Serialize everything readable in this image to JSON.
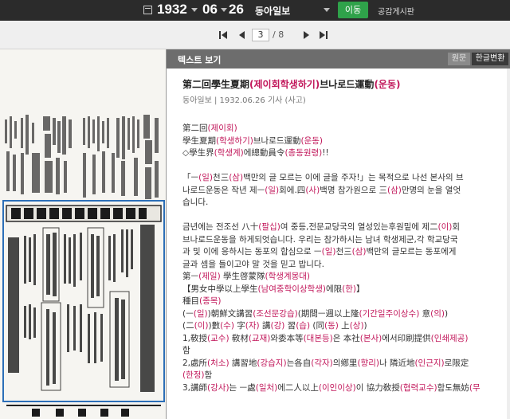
{
  "topbar": {
    "year": "1932",
    "month": "06",
    "day": "26",
    "newspaper": "동아일보",
    "go_label": "이동",
    "board_label": "공감게시판"
  },
  "pager": {
    "current_page": "3",
    "separator": "/",
    "total_pages": "8"
  },
  "panel": {
    "title": "텍스트 보기",
    "original_label": "원문",
    "convert_label": "한글변환"
  },
  "article": {
    "headline": [
      {
        "t": "第二回學生夏期"
      },
      {
        "t": "(제이회학생하기)",
        "h": true
      },
      {
        "t": "브나로드運動"
      },
      {
        "t": "(운동)",
        "h": true
      }
    ],
    "meta": "동아일보 | 1932.06.26 기사 (사고)",
    "lines": [
      [
        {
          "t": "第二回"
        },
        {
          "t": "(제이회)",
          "h": true
        }
      ],
      [
        {
          "t": "學生夏期"
        },
        {
          "t": "(학생하기)",
          "h": true
        },
        {
          "t": "브나로드運動"
        },
        {
          "t": "(운동)",
          "h": true
        }
      ],
      [
        {
          "t": "◇學生界"
        },
        {
          "t": "(학생계)",
          "h": true
        },
        {
          "t": "에總動員令"
        },
        {
          "t": "(총동원령)",
          "h": true
        },
        {
          "t": "!!"
        }
      ],
      [],
      [
        {
          "t": "「ㅡ"
        },
        {
          "t": "(일)",
          "h": true
        },
        {
          "t": "천三"
        },
        {
          "t": "(삼)",
          "h": true
        },
        {
          "t": "백만의 글 모르는 이에 글을 주자!」는 목적으로 나선 본사의 브"
        }
      ],
      [
        {
          "t": "나로드운동은 작년 제ㅡ"
        },
        {
          "t": "(일)",
          "h": true
        },
        {
          "t": "회에.四"
        },
        {
          "t": "(사)",
          "h": true
        },
        {
          "t": "백명 참가원으로 三"
        },
        {
          "t": "(삼)",
          "h": true
        },
        {
          "t": "만명의 눈을 열엇"
        }
      ],
      [
        {
          "t": "습니다."
        }
      ],
      [],
      [
        {
          "t": "금년에는 전조선 八十"
        },
        {
          "t": "(팔십)",
          "h": true
        },
        {
          "t": "여 중등,전문교당국의 열성있는후원밑에 제二"
        },
        {
          "t": "(이)",
          "h": true
        },
        {
          "t": "회"
        }
      ],
      [
        {
          "t": "브나로드운동을 하게되엇습니다. 우리는 참가하시는 남녀 학생제군,각 학교당국"
        }
      ],
      [
        {
          "t": "과 및 이에 응하시는 동포의 합심으로 ㅡ"
        },
        {
          "t": "(일)",
          "h": true
        },
        {
          "t": "천三"
        },
        {
          "t": "(삼)",
          "h": true
        },
        {
          "t": "백만의 글모르는 동포에게"
        }
      ],
      [
        {
          "t": "글과 셈을 들이고야 말 것을 믿고 밥니다."
        }
      ],
      [
        {
          "t": "第ㅡ"
        },
        {
          "t": "(제일)",
          "h": true
        },
        {
          "t": " 學生啓蒙隊"
        },
        {
          "t": "(학생계몽대)",
          "h": true
        }
      ],
      [
        {
          "t": "【男女中學以上學生"
        },
        {
          "t": "(남여중학이상학생)",
          "h": true
        },
        {
          "t": "에限"
        },
        {
          "t": "(한)",
          "h": true
        },
        {
          "t": "】"
        }
      ],
      [
        {
          "t": "種目"
        },
        {
          "t": "(종목)",
          "h": true
        }
      ],
      [
        {
          "t": "(ㅡ"
        },
        {
          "t": "(일)",
          "h": true
        },
        {
          "t": ")朝鮮文講習"
        },
        {
          "t": "(조선문강습)",
          "h": true
        },
        {
          "t": "(期間ㅡ週以上隆"
        },
        {
          "t": "(기간일주이상수)",
          "h": true
        },
        {
          "t": " 意"
        },
        {
          "t": "(의)",
          "h": true
        },
        {
          "t": ")"
        }
      ],
      [
        {
          "t": "(二"
        },
        {
          "t": "(이)",
          "h": true
        },
        {
          "t": ")數"
        },
        {
          "t": "(수)",
          "h": true
        },
        {
          "t": " 字"
        },
        {
          "t": "(자)",
          "h": true
        },
        {
          "t": " 講"
        },
        {
          "t": "(강)",
          "h": true
        },
        {
          "t": " 習"
        },
        {
          "t": "(습)",
          "h": true
        },
        {
          "t": " (同"
        },
        {
          "t": "(동)",
          "h": true
        },
        {
          "t": " 上"
        },
        {
          "t": "(상)",
          "h": true
        },
        {
          "t": ")"
        }
      ],
      [
        {
          "t": "1,敎授"
        },
        {
          "t": "(교수)",
          "h": true
        },
        {
          "t": " 敎材"
        },
        {
          "t": "(교재)",
          "h": true
        },
        {
          "t": "와委本等"
        },
        {
          "t": "(대본등)",
          "h": true
        },
        {
          "t": "은 本社"
        },
        {
          "t": "(본사)",
          "h": true
        },
        {
          "t": "에서印刷提供"
        },
        {
          "t": "(인쇄제공)",
          "h": true
        }
      ],
      [
        {
          "t": "함"
        }
      ],
      [
        {
          "t": "2,處所"
        },
        {
          "t": "(처소)",
          "h": true
        },
        {
          "t": " 講習地"
        },
        {
          "t": "(강습지)",
          "h": true
        },
        {
          "t": "는各自"
        },
        {
          "t": "(각자)",
          "h": true
        },
        {
          "t": "의鄕里"
        },
        {
          "t": "(향리)",
          "h": true
        },
        {
          "t": "나 隣近地"
        },
        {
          "t": "(인근지)",
          "h": true
        },
        {
          "t": "로限定"
        }
      ],
      [
        {
          "t": "(한정)",
          "h": true
        },
        {
          "t": "함"
        }
      ],
      [
        {
          "t": "3,講師"
        },
        {
          "t": "(강사)",
          "h": true
        },
        {
          "t": "는 ㅡ處"
        },
        {
          "t": "(일처)",
          "h": true
        },
        {
          "t": "에二人以上"
        },
        {
          "t": "(이인이상)",
          "h": true
        },
        {
          "t": "이 協力敎授"
        },
        {
          "t": "(협력교수)",
          "h": true
        },
        {
          "t": "함도無妨"
        },
        {
          "t": "(무",
          "h": true
        }
      ]
    ]
  }
}
